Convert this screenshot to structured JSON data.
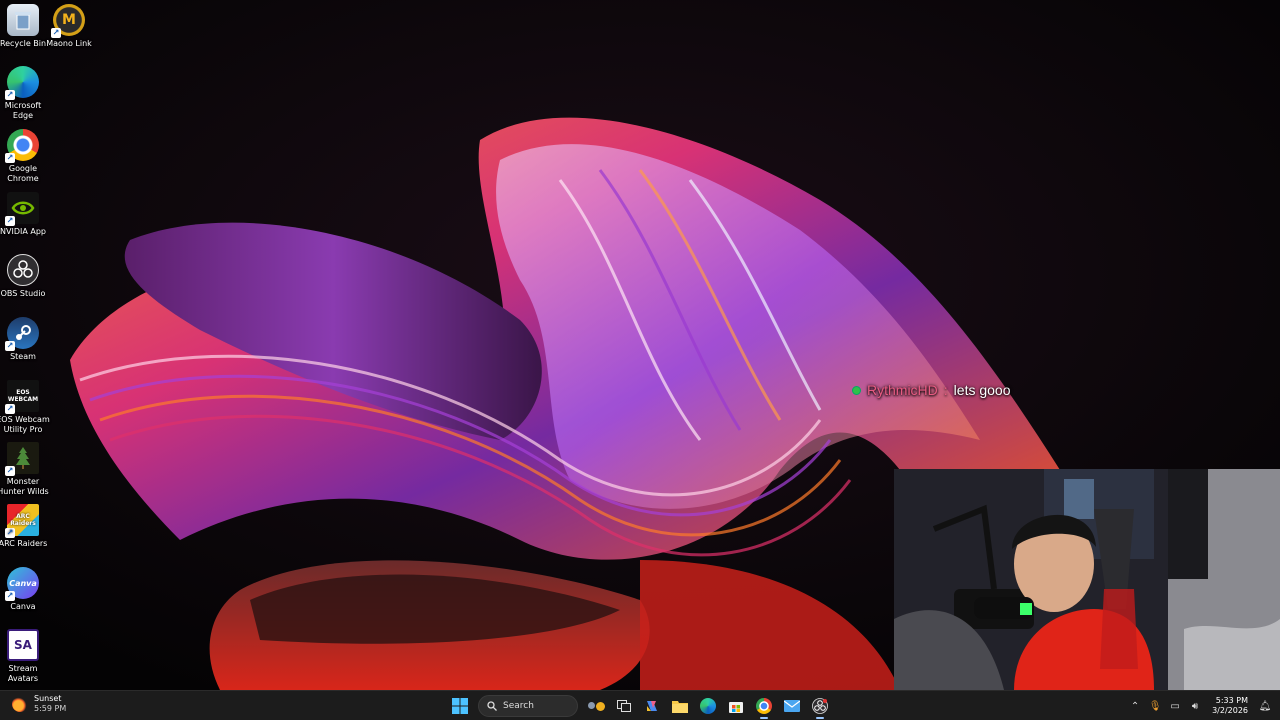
{
  "desktop_icons": [
    {
      "label": "Recycle Bin",
      "icon": "recycle-bin-icon"
    },
    {
      "label": "Maono Link",
      "icon": "maono-link-icon"
    },
    {
      "label": "Microsoft Edge",
      "icon": "edge-icon"
    },
    {
      "label": "Google Chrome",
      "icon": "chrome-icon"
    },
    {
      "label": "NVIDIA App",
      "icon": "nvidia-icon"
    },
    {
      "label": "OBS Studio",
      "icon": "obs-icon"
    },
    {
      "label": "Steam",
      "icon": "steam-icon"
    },
    {
      "label": "EOS Webcam Utility Pro",
      "icon": "eos-webcam-icon",
      "icon_text": "EOS WEBCAM"
    },
    {
      "label": "Monster Hunter Wilds",
      "icon": "monster-hunter-icon"
    },
    {
      "label": "ARC Raiders",
      "icon": "arc-raiders-icon",
      "icon_text": "ARC Raiders"
    },
    {
      "label": "Canva",
      "icon": "canva-icon",
      "icon_text": "Canva"
    },
    {
      "label": "Stream Avatars",
      "icon": "stream-avatars-icon",
      "icon_text": "SA"
    }
  ],
  "chat_overlay": {
    "username": "RythmicHD",
    "separator": ":",
    "message": "lets gooo"
  },
  "taskbar": {
    "weather": {
      "condition": "Sunset",
      "time": "5:59 PM"
    },
    "search_placeholder": "Search",
    "pinned": [
      "start-icon",
      "search",
      "task-view-icon",
      "copilot-icon",
      "file-explorer-icon",
      "edge-icon",
      "store-icon",
      "chrome-icon",
      "mail-icon",
      "obs-icon"
    ],
    "tray": {
      "time": "5:33 PM",
      "date": "3/2/2026"
    }
  },
  "colors": {
    "taskbar_bg": "#1c1c1c",
    "chat_username": "#e85a82",
    "accent": "#9ac7ff"
  }
}
